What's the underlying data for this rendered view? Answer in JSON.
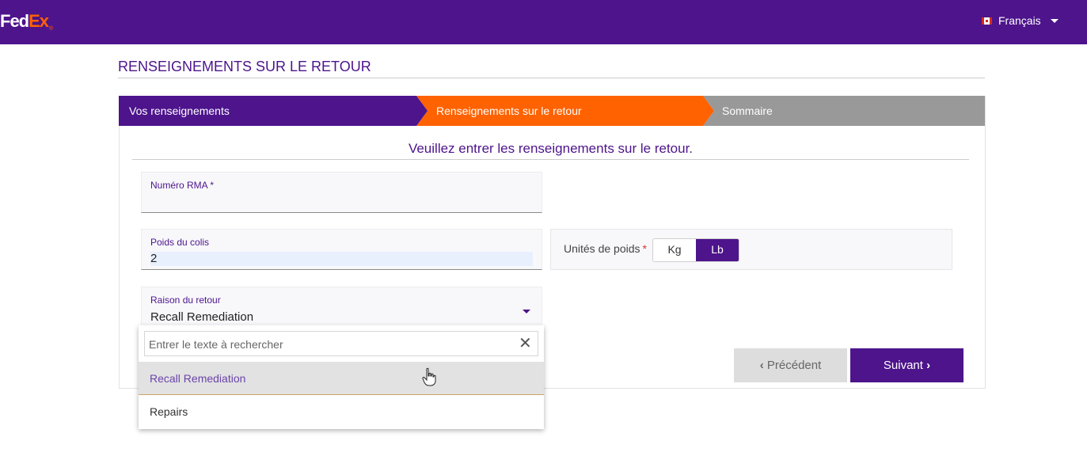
{
  "header": {
    "logo_fed": "Fed",
    "logo_ex": "Ex",
    "logo_reg": "®",
    "language": "Français",
    "language_flag": "canada-flag-icon"
  },
  "section_title": "RENSEIGNEMENTS SUR LE RETOUR",
  "steps": [
    {
      "label": "Vos renseignements",
      "state": "completed"
    },
    {
      "label": "Renseignements sur le retour",
      "state": "active"
    },
    {
      "label": "Sommaire",
      "state": "pending"
    }
  ],
  "instruction": "Veuillez entrer les renseignements sur le retour.",
  "form": {
    "rma_label": "Numéro RMA *",
    "rma_value": "",
    "weight_label": "Poids du colis",
    "weight_value": "2",
    "units_label": "Unités de poids",
    "units_required": "*",
    "unit_kg": "Kg",
    "unit_lb": "Lb",
    "unit_selected": "Lb",
    "reason_label": "Raison du retour",
    "reason_value": "Recall Remediation"
  },
  "dropdown": {
    "search_placeholder": "Entrer le texte à rechercher",
    "close_icon": "close-icon",
    "options": [
      "Recall Remediation",
      "Repairs"
    ],
    "highlighted": "Recall Remediation"
  },
  "buttons": {
    "prev_label": "Précédent",
    "next_label": "Suivant"
  },
  "colors": {
    "brand_purple": "#4d148c",
    "brand_orange": "#ff6200",
    "step_pending": "#999999"
  }
}
